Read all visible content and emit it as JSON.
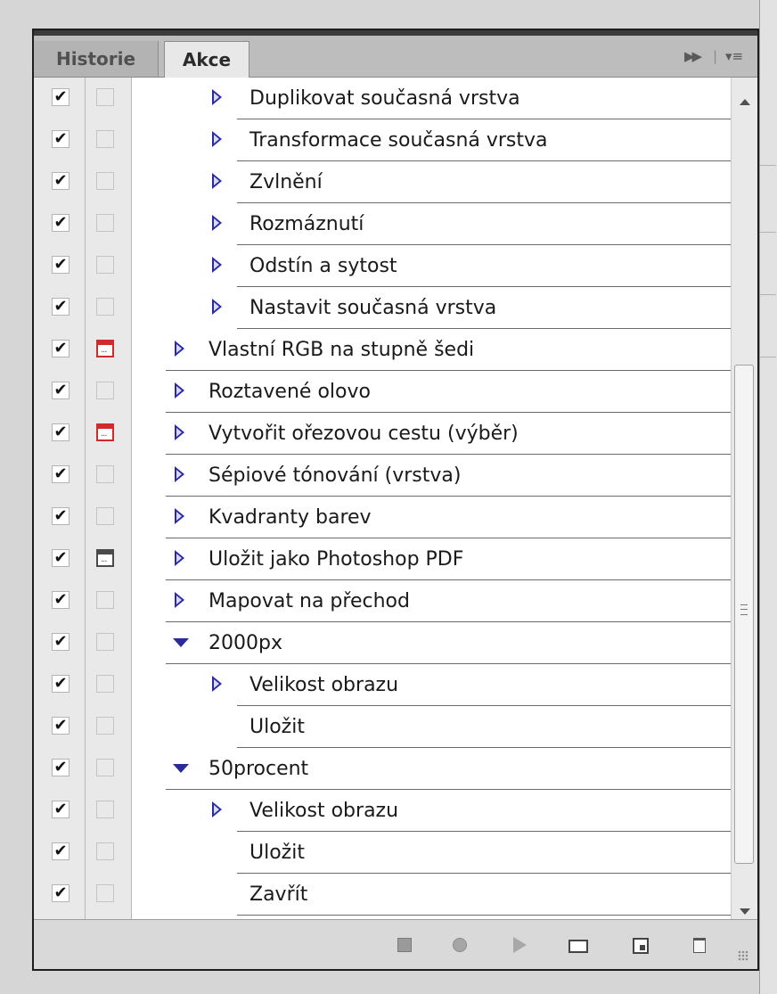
{
  "tabs": [
    {
      "label": "Historie",
      "active": false
    },
    {
      "label": "Akce",
      "active": true
    }
  ],
  "tab_controls": {
    "ffwd_icon": "double-chevron-right-icon",
    "separator": "|",
    "menu_icon": "panel-menu-icon"
  },
  "rows": [
    {
      "label": "Duplikovat současná vrstva",
      "level": 2,
      "expander": "collapsed",
      "checked": true,
      "dialog": "none"
    },
    {
      "label": "Transformace současná vrstva",
      "level": 2,
      "expander": "collapsed",
      "checked": true,
      "dialog": "none"
    },
    {
      "label": "Zvlnění",
      "level": 2,
      "expander": "collapsed",
      "checked": true,
      "dialog": "none"
    },
    {
      "label": "Rozmáznutí",
      "level": 2,
      "expander": "collapsed",
      "checked": true,
      "dialog": "none"
    },
    {
      "label": "Odstín a sytost",
      "level": 2,
      "expander": "collapsed",
      "checked": true,
      "dialog": "none"
    },
    {
      "label": "Nastavit současná vrstva",
      "level": 2,
      "expander": "collapsed",
      "checked": true,
      "dialog": "none"
    },
    {
      "label": "Vlastní RGB na stupně šedi",
      "level": 1,
      "expander": "collapsed",
      "checked": true,
      "dialog": "red"
    },
    {
      "label": "Roztavené olovo",
      "level": 1,
      "expander": "collapsed",
      "checked": true,
      "dialog": "none"
    },
    {
      "label": "Vytvořit ořezovou cestu (výběr)",
      "level": 1,
      "expander": "collapsed",
      "checked": true,
      "dialog": "red"
    },
    {
      "label": "Sépiové tónování (vrstva)",
      "level": 1,
      "expander": "collapsed",
      "checked": true,
      "dialog": "none"
    },
    {
      "label": "Kvadranty barev",
      "level": 1,
      "expander": "collapsed",
      "checked": true,
      "dialog": "none"
    },
    {
      "label": "Uložit jako Photoshop PDF",
      "level": 1,
      "expander": "collapsed",
      "checked": true,
      "dialog": "black"
    },
    {
      "label": "Mapovat na přechod",
      "level": 1,
      "expander": "collapsed",
      "checked": true,
      "dialog": "none"
    },
    {
      "label": "2000px",
      "level": 1,
      "expander": "expanded",
      "checked": true,
      "dialog": "none"
    },
    {
      "label": "Velikost obrazu",
      "level": 2,
      "expander": "collapsed",
      "checked": true,
      "dialog": "none"
    },
    {
      "label": "Uložit",
      "level": 2,
      "expander": "none",
      "checked": true,
      "dialog": "none"
    },
    {
      "label": "50procent",
      "level": 1,
      "expander": "expanded",
      "checked": true,
      "dialog": "none"
    },
    {
      "label": "Velikost obrazu",
      "level": 2,
      "expander": "collapsed",
      "checked": true,
      "dialog": "none"
    },
    {
      "label": "Uložit",
      "level": 2,
      "expander": "none",
      "checked": true,
      "dialog": "none"
    },
    {
      "label": "Zavřít",
      "level": 2,
      "expander": "none",
      "checked": true,
      "dialog": "none"
    }
  ],
  "check_glyph": "✔",
  "bottom_toolbar": [
    {
      "name": "stop-playing-button",
      "icon": "stop-icon"
    },
    {
      "name": "record-button",
      "icon": "record-icon"
    },
    {
      "name": "play-selection-button",
      "icon": "play-icon"
    },
    {
      "name": "new-set-button",
      "icon": "folder-icon"
    },
    {
      "name": "new-action-button",
      "icon": "new-item-icon"
    },
    {
      "name": "delete-button",
      "icon": "trash-icon"
    }
  ],
  "colors": {
    "expander": "#2a2a9a",
    "dialog_red": "#d02a2a",
    "panel_bg": "#f0f0f0"
  }
}
